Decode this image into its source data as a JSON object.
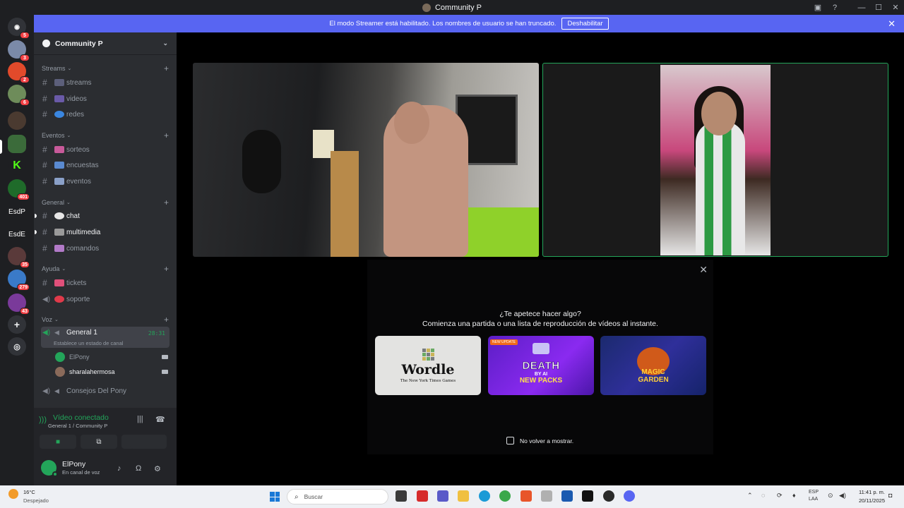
{
  "window": {
    "title": "Community P"
  },
  "banner": {
    "text": "El modo Streamer está habilitado. Los nombres de usuario se han truncado.",
    "button": "Deshabilitar"
  },
  "rail": {
    "badges": [
      "5",
      "3",
      "2",
      "6",
      "401",
      "35",
      "279",
      "43"
    ],
    "text_servers": [
      "EsdP",
      "EsdE"
    ]
  },
  "server": {
    "name": "Community P",
    "categories": [
      {
        "name": "Streams",
        "channels": [
          "streams",
          "videos",
          "redes"
        ]
      },
      {
        "name": "Eventos",
        "channels": [
          "sorteos",
          "encuestas",
          "eventos"
        ]
      },
      {
        "name": "General",
        "channels": [
          "chat",
          "multimedia",
          "comandos"
        ]
      },
      {
        "name": "Ayuda",
        "channels": [
          "tickets",
          "soporte"
        ]
      },
      {
        "name": "Voz",
        "channels": [
          "General 1",
          "Consejos Del Pony"
        ]
      }
    ],
    "voice_timer": "28:31",
    "status_hint": "Establece un estado de canal",
    "voice_users": [
      "ElPony",
      "sharalahermosa"
    ]
  },
  "voice_panel": {
    "status": "Vídeo conectado",
    "location": "General 1 / Community P"
  },
  "user": {
    "name": "ElPony",
    "status": "En canal de voz"
  },
  "activity": {
    "question": "¿Te apetece hacer algo?",
    "subtitle": "Comienza una partida o una lista de reproducción de vídeos al instante.",
    "wordle_title": "Wordle",
    "wordle_sub": "The New York Times Games",
    "death_tag": "NEW UPDATE",
    "death_title": "DEATH",
    "death_by": "BY AI",
    "death_packs": "NEW PACKS",
    "magic_title1": "MAGIC",
    "magic_title2": "GARDEN",
    "dont_show": "No volver a mostrar."
  },
  "taskbar": {
    "temp": "16°C",
    "condition": "Despejado",
    "search": "Buscar",
    "lang1": "ESP",
    "lang2": "LAA",
    "time": "11:41 p. m.",
    "date": "20/11/2025"
  },
  "colors": {
    "accent": "#5865f2",
    "online": "#23a55a",
    "badge": "#f23f43"
  }
}
